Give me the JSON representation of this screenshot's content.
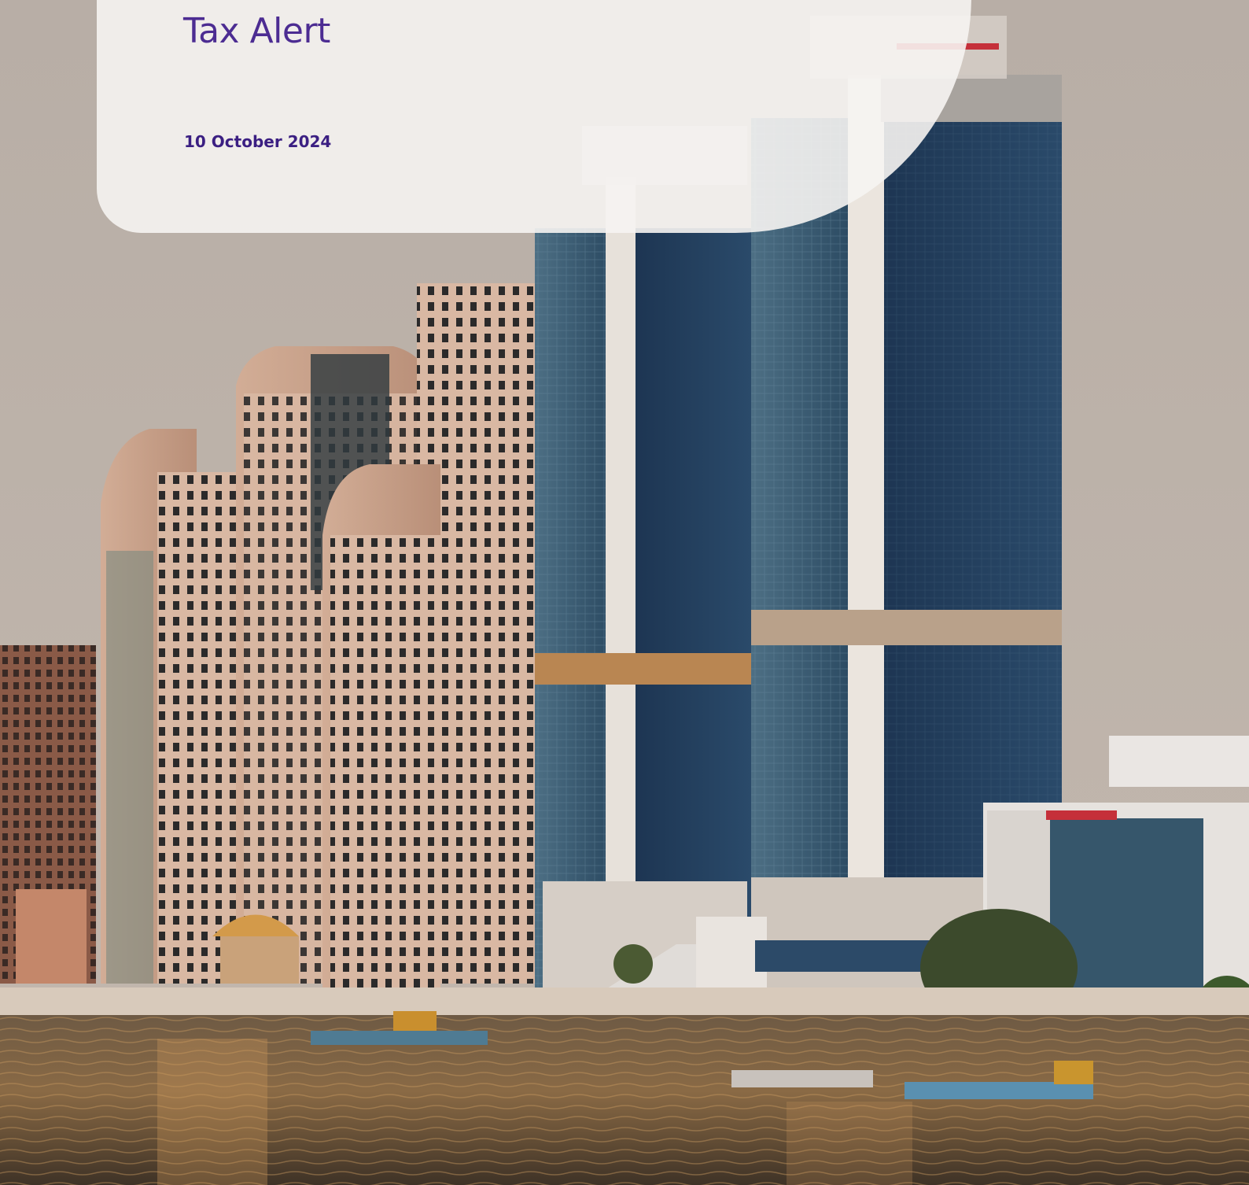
{
  "document": {
    "title": "Tax Alert",
    "date": "10 October 2024"
  },
  "colors": {
    "accent": "#4c2c92",
    "date_text": "#3b1f82",
    "panel": "#f6f4f2"
  },
  "cover_image": {
    "subject": "skyline-photo"
  }
}
